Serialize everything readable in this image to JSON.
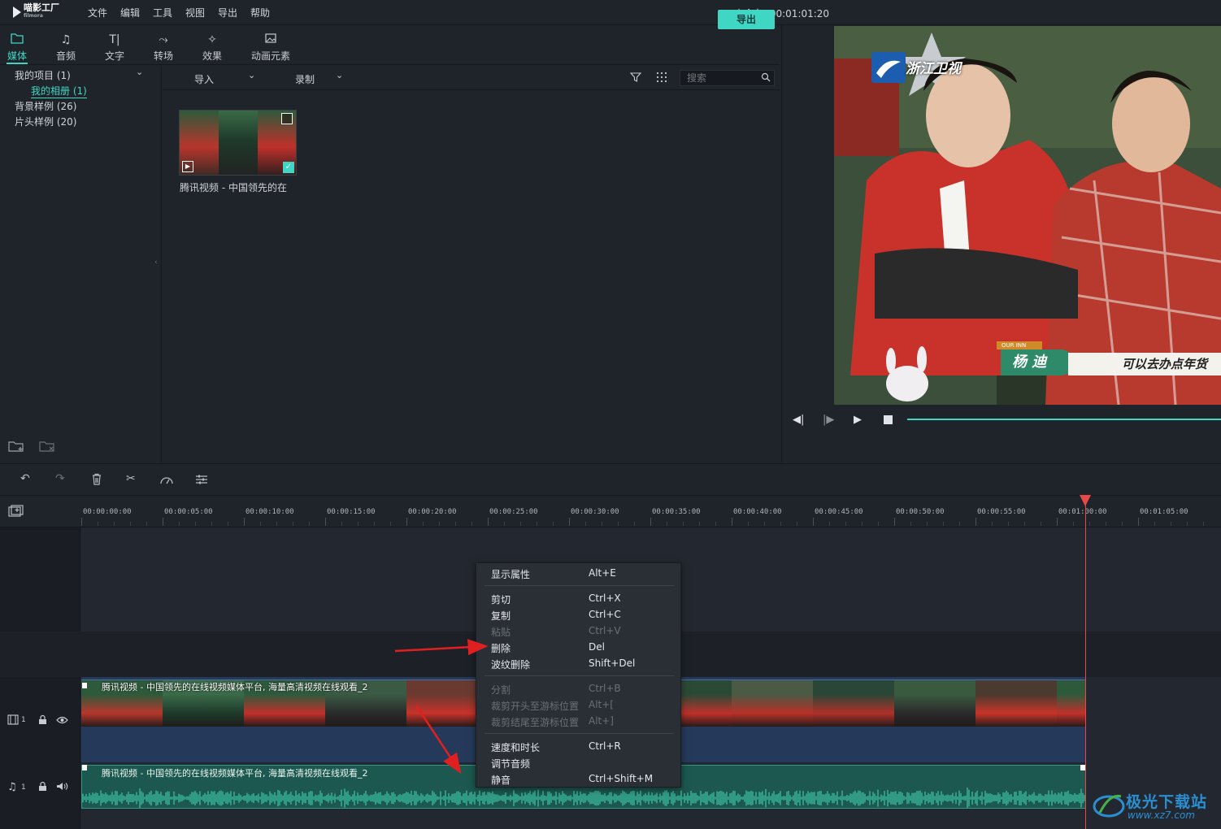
{
  "app": {
    "logo_text": "喵影工厂",
    "logo_sub": "filmora",
    "project_title": "未命名: 00:01:01:20"
  },
  "menubar": [
    "文件",
    "编辑",
    "工具",
    "视图",
    "导出",
    "帮助"
  ],
  "media_tabs": [
    {
      "label": "媒体",
      "icon": "folder-icon",
      "active": true
    },
    {
      "label": "音频",
      "icon": "music-note-icon",
      "active": false
    },
    {
      "label": "文字",
      "icon": "text-icon",
      "active": false
    },
    {
      "label": "转场",
      "icon": "transition-icon",
      "active": false
    },
    {
      "label": "效果",
      "icon": "effects-icon",
      "active": false
    },
    {
      "label": "动画元素",
      "icon": "image-icon",
      "active": false
    }
  ],
  "export_label": "导出",
  "folders": {
    "my_project": "我的项目 (1)",
    "my_album": "我的相册 (1)",
    "bg_samples": "背景样例 (26)",
    "intro_samples": "片头样例 (20)"
  },
  "bin_toolbar": {
    "import_label": "导入",
    "record_label": "录制",
    "search_placeholder": "搜索"
  },
  "media_item": {
    "caption": "腾讯视频 - 中国领先的在"
  },
  "preview": {
    "channel_logo": "浙江卫视",
    "lower_third_tag": "OUR INN",
    "lower_third_name": "杨 迪",
    "subtitle": "可以去办点年货"
  },
  "ruler_labels": [
    "00:00:00:00",
    "00:00:05:00",
    "00:00:10:00",
    "00:00:15:00",
    "00:00:20:00",
    "00:00:25:00",
    "00:00:30:00",
    "00:00:35:00",
    "00:00:40:00",
    "00:00:45:00",
    "00:00:50:00",
    "00:00:55:00",
    "00:01:00:00",
    "00:01:05:00"
  ],
  "tracks": {
    "video_num": "1",
    "audio_num": "1",
    "video_clip_title": "腾讯视频 - 中国领先的在线视频媒体平台, 海量高清视频在线观看_2",
    "audio_clip_title": "腾讯视频 - 中国领先的在线视频媒体平台, 海量高清视频在线观看_2"
  },
  "context_menu": [
    {
      "label": "显示属性",
      "key": "Alt+E",
      "disabled": false
    },
    {
      "label": "剪切",
      "key": "Ctrl+X",
      "disabled": false
    },
    {
      "label": "复制",
      "key": "Ctrl+C",
      "disabled": false
    },
    {
      "label": "粘贴",
      "key": "Ctrl+V",
      "disabled": true
    },
    {
      "label": "删除",
      "key": "Del",
      "disabled": false
    },
    {
      "label": "波纹删除",
      "key": "Shift+Del",
      "disabled": false
    },
    {
      "label": "分割",
      "key": "Ctrl+B",
      "disabled": true
    },
    {
      "label": "裁剪开头至游标位置",
      "key": "Alt+[",
      "disabled": true
    },
    {
      "label": "裁剪结尾至游标位置",
      "key": "Alt+]",
      "disabled": true
    },
    {
      "label": "速度和时长",
      "key": "Ctrl+R",
      "disabled": false
    },
    {
      "label": "调节音频",
      "key": "",
      "disabled": false
    },
    {
      "label": "静音",
      "key": "Ctrl+Shift+M",
      "disabled": false
    }
  ],
  "watermark": {
    "text": "极光下载站",
    "url": "www.xz7.com"
  },
  "colors": {
    "accent": "#3fd7c3",
    "playhead": "#e84848",
    "annotation_arrow": "#e02020"
  }
}
